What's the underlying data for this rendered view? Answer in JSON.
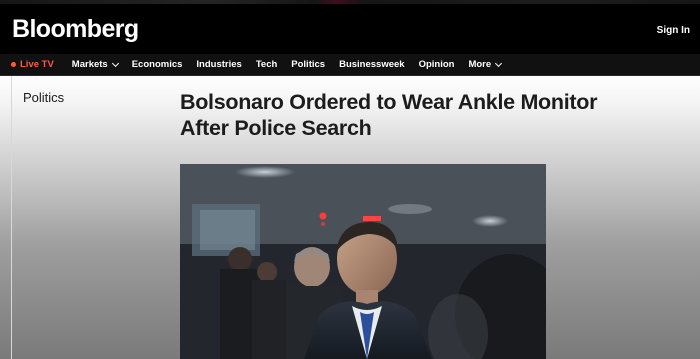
{
  "header": {
    "logo": "Bloomberg",
    "sign_in": "Sign In"
  },
  "nav": {
    "live": "Live TV",
    "items": [
      "Markets",
      "Economics",
      "Industries",
      "Tech",
      "Politics",
      "Businessweek",
      "Opinion",
      "More"
    ]
  },
  "article": {
    "section": "Politics",
    "headline": "Bolsonaro Ordered to Wear Ankle Monitor After Police Search"
  },
  "colors": {
    "header_bg": "#000000",
    "live_accent": "#ff5a3d",
    "headline_text": "#1c1c1c"
  }
}
